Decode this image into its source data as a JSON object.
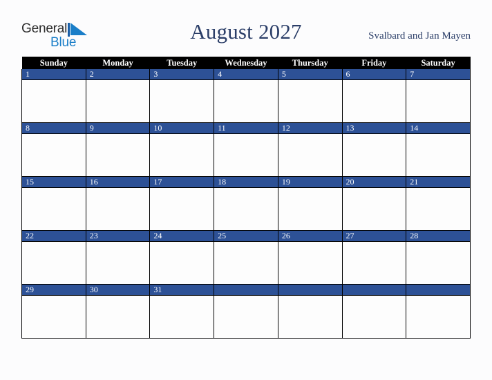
{
  "brand": {
    "name_part1": "General",
    "name_part2": "Blue",
    "triangle_icon": "triangle-icon",
    "colors": {
      "text_dark": "#2b2b2b",
      "blue": "#1a7ec8"
    }
  },
  "header": {
    "title": "August 2027",
    "subtitle": "Svalbard and Jan Mayen"
  },
  "colors": {
    "day_banner": "#2d5196",
    "header_row": "#000000",
    "title_navy": "#2b3e68",
    "page_background": "#fcfcfd",
    "cell_background": "#fdfdfd"
  },
  "calendar": {
    "month": "August",
    "year": "2027",
    "weekday_headers": [
      "Sunday",
      "Monday",
      "Tuesday",
      "Wednesday",
      "Thursday",
      "Friday",
      "Saturday"
    ],
    "weeks": [
      [
        {
          "day": "1",
          "note": ""
        },
        {
          "day": "2",
          "note": ""
        },
        {
          "day": "3",
          "note": ""
        },
        {
          "day": "4",
          "note": ""
        },
        {
          "day": "5",
          "note": ""
        },
        {
          "day": "6",
          "note": ""
        },
        {
          "day": "7",
          "note": ""
        }
      ],
      [
        {
          "day": "8",
          "note": ""
        },
        {
          "day": "9",
          "note": ""
        },
        {
          "day": "10",
          "note": ""
        },
        {
          "day": "11",
          "note": ""
        },
        {
          "day": "12",
          "note": ""
        },
        {
          "day": "13",
          "note": ""
        },
        {
          "day": "14",
          "note": ""
        }
      ],
      [
        {
          "day": "15",
          "note": ""
        },
        {
          "day": "16",
          "note": ""
        },
        {
          "day": "17",
          "note": ""
        },
        {
          "day": "18",
          "note": ""
        },
        {
          "day": "19",
          "note": ""
        },
        {
          "day": "20",
          "note": ""
        },
        {
          "day": "21",
          "note": ""
        }
      ],
      [
        {
          "day": "22",
          "note": ""
        },
        {
          "day": "23",
          "note": ""
        },
        {
          "day": "24",
          "note": ""
        },
        {
          "day": "25",
          "note": ""
        },
        {
          "day": "26",
          "note": ""
        },
        {
          "day": "27",
          "note": ""
        },
        {
          "day": "28",
          "note": ""
        }
      ],
      [
        {
          "day": "29",
          "note": ""
        },
        {
          "day": "30",
          "note": ""
        },
        {
          "day": "31",
          "note": ""
        },
        {
          "day": "",
          "note": ""
        },
        {
          "day": "",
          "note": ""
        },
        {
          "day": "",
          "note": ""
        },
        {
          "day": "",
          "note": ""
        }
      ]
    ]
  }
}
